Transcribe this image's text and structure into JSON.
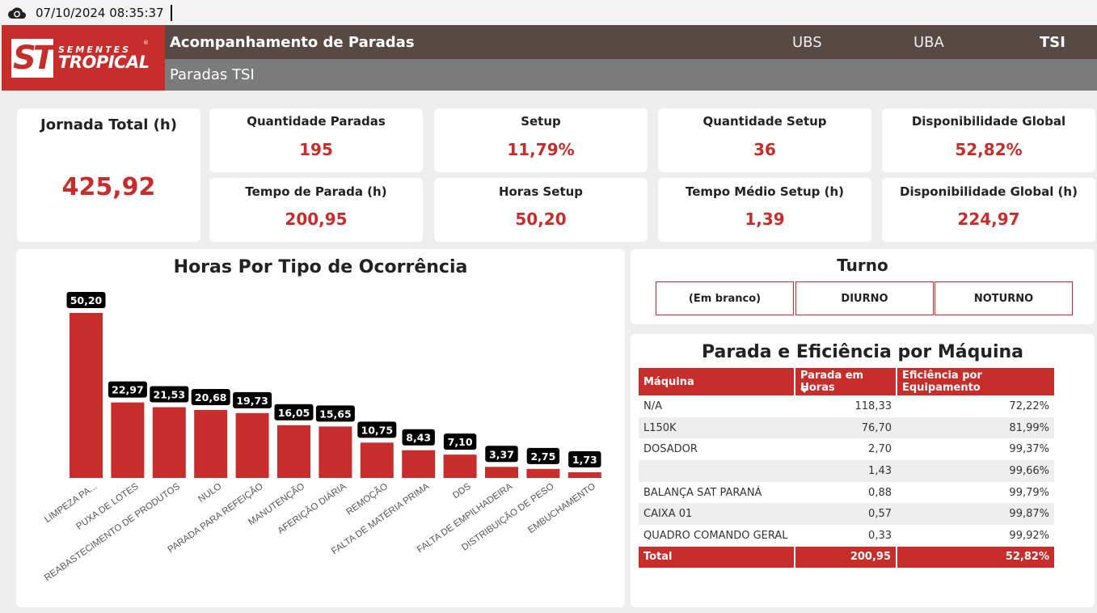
{
  "topbar": {
    "timestamp": "07/10/2024 08:35:37",
    "refresh_icon": "cloud-refresh-icon"
  },
  "brand": {
    "line1": "SEMENTES",
    "line2": "TROPICAL",
    "mark": "ST",
    "reg": "®"
  },
  "header": {
    "title": "Acompanhamento de Paradas",
    "subtitle": "Paradas TSI",
    "nav": [
      {
        "label": "UBS",
        "active": false
      },
      {
        "label": "UBA",
        "active": false
      },
      {
        "label": "TSI",
        "active": true
      }
    ]
  },
  "kpis": {
    "jornada_total": {
      "label": "Jornada Total (h)",
      "value": "425,92"
    },
    "quantidade_paradas": {
      "label": "Quantidade Paradas",
      "value": "195"
    },
    "setup": {
      "label": "Setup",
      "value": "11,79%"
    },
    "quantidade_setup": {
      "label": "Quantidade Setup",
      "value": "36"
    },
    "disponibilidade_global": {
      "label": "Disponibilidade Global",
      "value": "52,82%"
    },
    "tempo_parada": {
      "label": "Tempo de Parada (h)",
      "value": "200,95"
    },
    "horas_setup": {
      "label": "Horas Setup",
      "value": "50,20"
    },
    "tempo_medio_setup": {
      "label": "Tempo Médio Setup (h)",
      "value": "1,39"
    },
    "disponibilidade_global_h": {
      "label": "Disponibilidade Global (h)",
      "value": "224,97"
    }
  },
  "chart_data": {
    "type": "bar",
    "title": "Horas Por Tipo de Ocorrência",
    "categories": [
      "LIMPEZA PA...",
      "PUXA DE LOTES",
      "REABASTECIMENTO DE PRODUTOS",
      "NULO",
      "PARADA PARA REFEIÇÃO",
      "MANUTENÇÃO",
      "AFERIÇÃO DIÁRIA",
      "REMOÇÃO",
      "FALTA DE MATÉRIA PRIMA",
      "DDS",
      "FALTA DE EMPILHADEIRA",
      "DISTRIBUIÇÃO DE PESO",
      "EMBUCHAMENTO"
    ],
    "values": [
      50.2,
      22.97,
      21.53,
      20.68,
      19.73,
      16.05,
      15.65,
      10.75,
      8.43,
      7.1,
      3.37,
      2.75,
      1.73
    ],
    "value_labels": [
      "50,20",
      "22,97",
      "21,53",
      "20,68",
      "19,73",
      "16,05",
      "15,65",
      "10,75",
      "8,43",
      "7,10",
      "3,37",
      "2,75",
      "1,73"
    ],
    "ylim": [
      0,
      50.2
    ],
    "grid": false,
    "bar_color": "#c62d2b"
  },
  "turno": {
    "title": "Turno",
    "options": [
      "(Em branco)",
      "DIURNO",
      "NOTURNO"
    ]
  },
  "machine_table": {
    "title": "Parada e Eficiência por Máquina",
    "columns": [
      "Máquina",
      "Parada em Horas",
      "Eficiência por Equipamento"
    ],
    "rows": [
      [
        "N/A",
        "118,33",
        "72,22%"
      ],
      [
        "L150K",
        "76,70",
        "81,99%"
      ],
      [
        "DOSADOR",
        "2,70",
        "99,37%"
      ],
      [
        "",
        "1,43",
        "99,66%"
      ],
      [
        "BALANÇA SAT PARANÁ",
        "0,88",
        "99,79%"
      ],
      [
        "CAIXA 01",
        "0,57",
        "99,87%"
      ],
      [
        "QUADRO COMANDO GERAL",
        "0,33",
        "99,92%"
      ]
    ],
    "total": [
      "Total",
      "200,95",
      "52,82%"
    ]
  },
  "colors": {
    "accent": "#c62d2b",
    "header_dark": "#574a44",
    "header_sub": "#7b7b7b"
  }
}
